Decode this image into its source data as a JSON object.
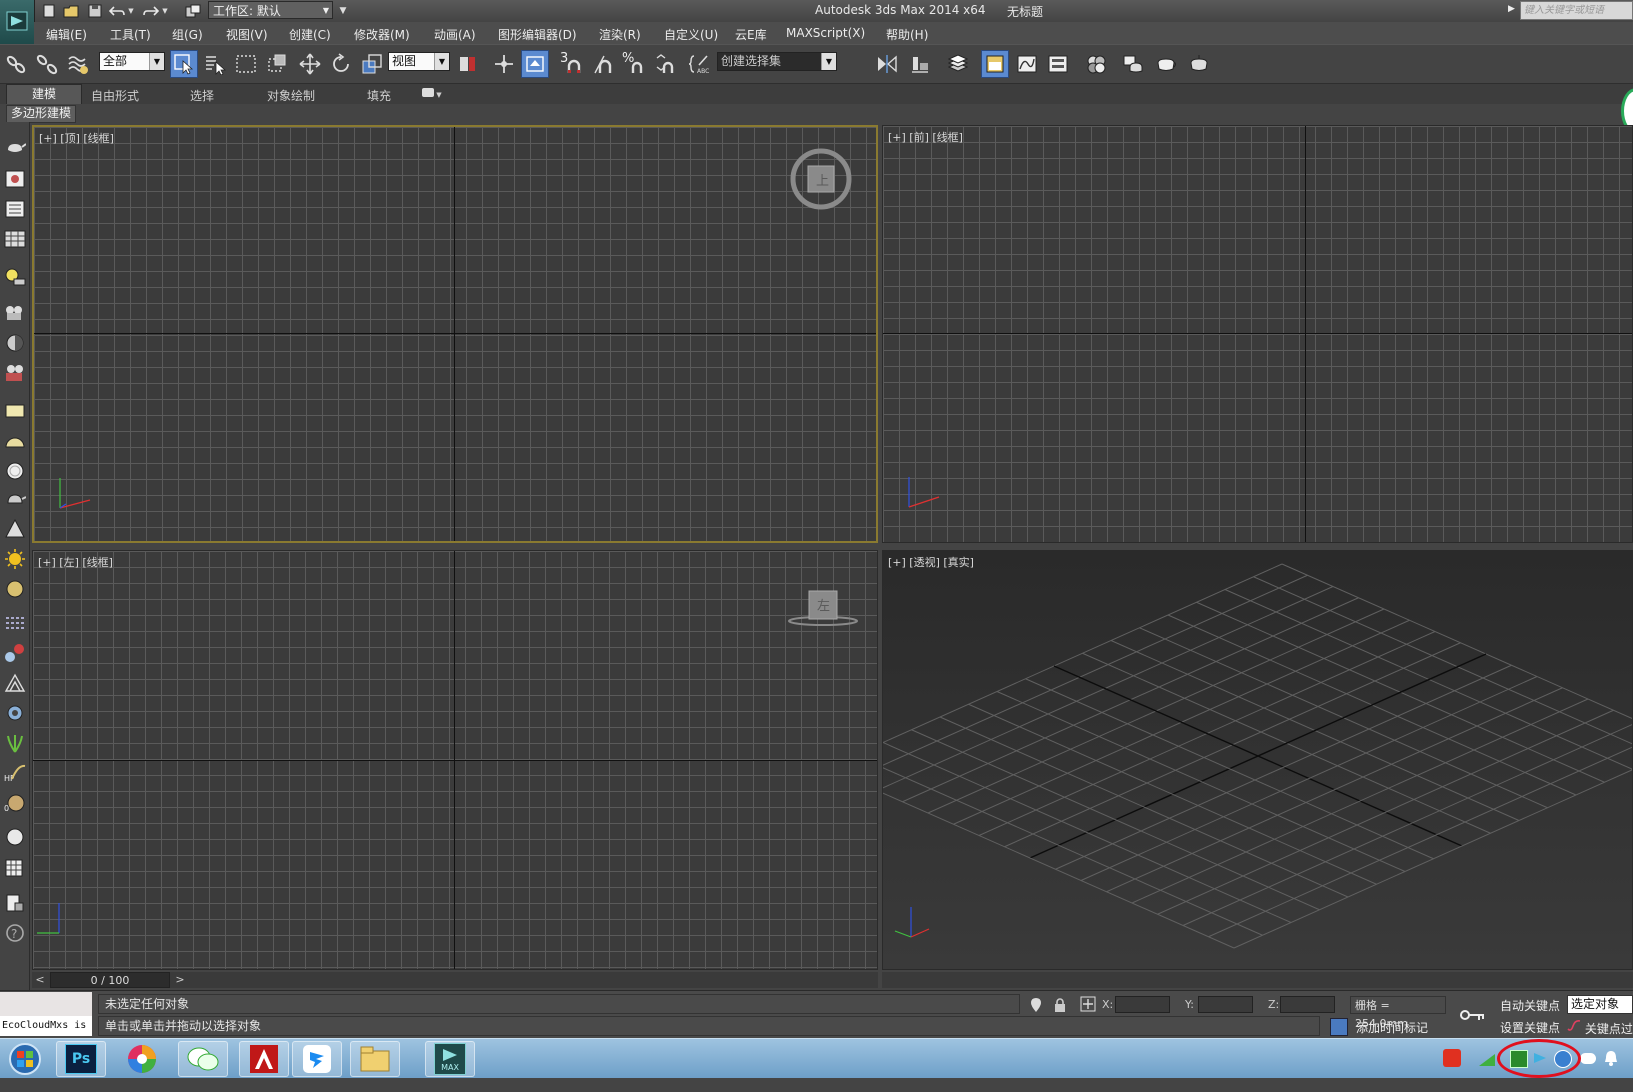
{
  "title_bar": {
    "app_title": "Autodesk 3ds Max  2014 x64",
    "document_title": "无标题",
    "workspace": "工作区: 默认",
    "help_search_placeholder": "键入关键字或短语"
  },
  "menu": {
    "items": [
      "编辑(E)",
      "工具(T)",
      "组(G)",
      "视图(V)",
      "创建(C)",
      "修改器(M)",
      "动画(A)",
      "图形编辑器(D)",
      "渲染(R)",
      "自定义(U)",
      "云E库",
      "MAXScript(X)",
      "帮助(H)"
    ]
  },
  "toolbar": {
    "selection_filter": "全部",
    "reference_coord": "视图",
    "named_selection_placeholder": "创建选择集",
    "snap_3d_label": "3",
    "percent_snap_label": "%"
  },
  "ribbon": {
    "tabs": [
      "建模",
      "自由形式",
      "选择",
      "对象绘制",
      "填充"
    ],
    "active_tab": "建模",
    "panel_label": "多边形建模"
  },
  "viewports": {
    "top": {
      "label": "[+] [顶] [线框]",
      "viewcube_label": "上"
    },
    "front": {
      "label": "[+] [前] [线框]"
    },
    "left": {
      "label": "[+] [左] [线框]",
      "viewcube_label": "左"
    },
    "perspective": {
      "label": "[+] [透视] [真实]"
    }
  },
  "time_slider": {
    "frame_readout": "0 / 100",
    "prev_label": "<",
    "next_label": ">"
  },
  "status": {
    "maxscript_line": "EcoCloudMxs is",
    "prompt_1": "未选定任何对象",
    "prompt_2": "单击或单击并拖动以选择对象",
    "x_label": "X:",
    "y_label": "Y:",
    "z_label": "Z:",
    "grid_info": "栅格 = 254.0mm",
    "auto_key": "自动关键点",
    "selected_object": "选定对象",
    "set_key": "设置关键点",
    "key_filters": "关键点过滤器",
    "add_time_tag": "添加时间标记"
  },
  "taskbar": {
    "apps": [
      "start-orb",
      "photoshop",
      "picasa",
      "wechat",
      "autocad",
      "dingtalk",
      "file-explorer",
      "3dsmax"
    ],
    "photoshop_label": "Ps",
    "max_label": "MAX"
  },
  "colors": {
    "active_viewport_border": "#8a7a30",
    "active_button": "#5b8ad0",
    "tray_highlight": "#e0101e",
    "taskbar": "#6d9fc8"
  }
}
